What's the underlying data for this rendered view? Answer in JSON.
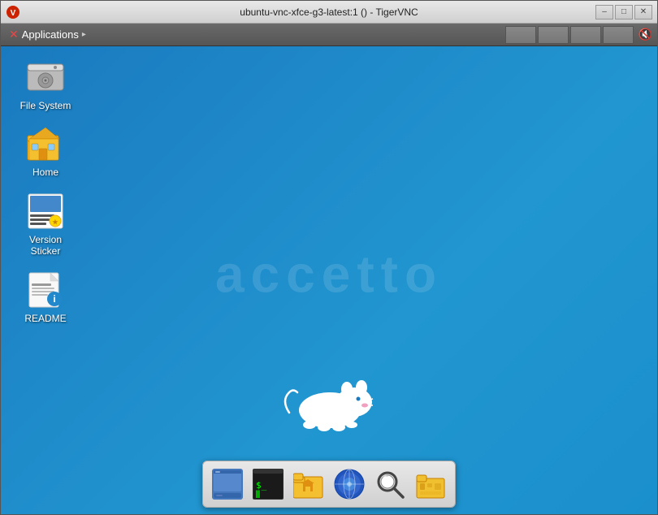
{
  "window": {
    "title": "ubuntu-vnc-xfce-g3-latest:1 () - TigerVNC",
    "controls": {
      "minimize": "–",
      "maximize": "□",
      "close": "✕"
    }
  },
  "taskbar": {
    "applications_label": "Applications",
    "indicators": [
      {
        "id": 1,
        "active": false
      },
      {
        "id": 2,
        "active": false
      },
      {
        "id": 3,
        "active": false
      },
      {
        "id": 4,
        "active": false
      }
    ],
    "volume": "🔇"
  },
  "desktop": {
    "watermark": "accetto",
    "icons": [
      {
        "id": "filesystem",
        "label": "File System"
      },
      {
        "id": "home",
        "label": "Home"
      },
      {
        "id": "sticker",
        "label": "Version\nSticker"
      },
      {
        "id": "readme",
        "label": "README"
      }
    ]
  },
  "dock": {
    "items": [
      {
        "id": "showdesktop",
        "label": "Show Desktop"
      },
      {
        "id": "terminal",
        "label": "Terminal",
        "symbol": "$_"
      },
      {
        "id": "files",
        "label": "File Manager"
      },
      {
        "id": "browser",
        "label": "Web Browser"
      },
      {
        "id": "search",
        "label": "Search",
        "symbol": "🔍"
      },
      {
        "id": "filemanager2",
        "label": "Thunar"
      }
    ]
  }
}
